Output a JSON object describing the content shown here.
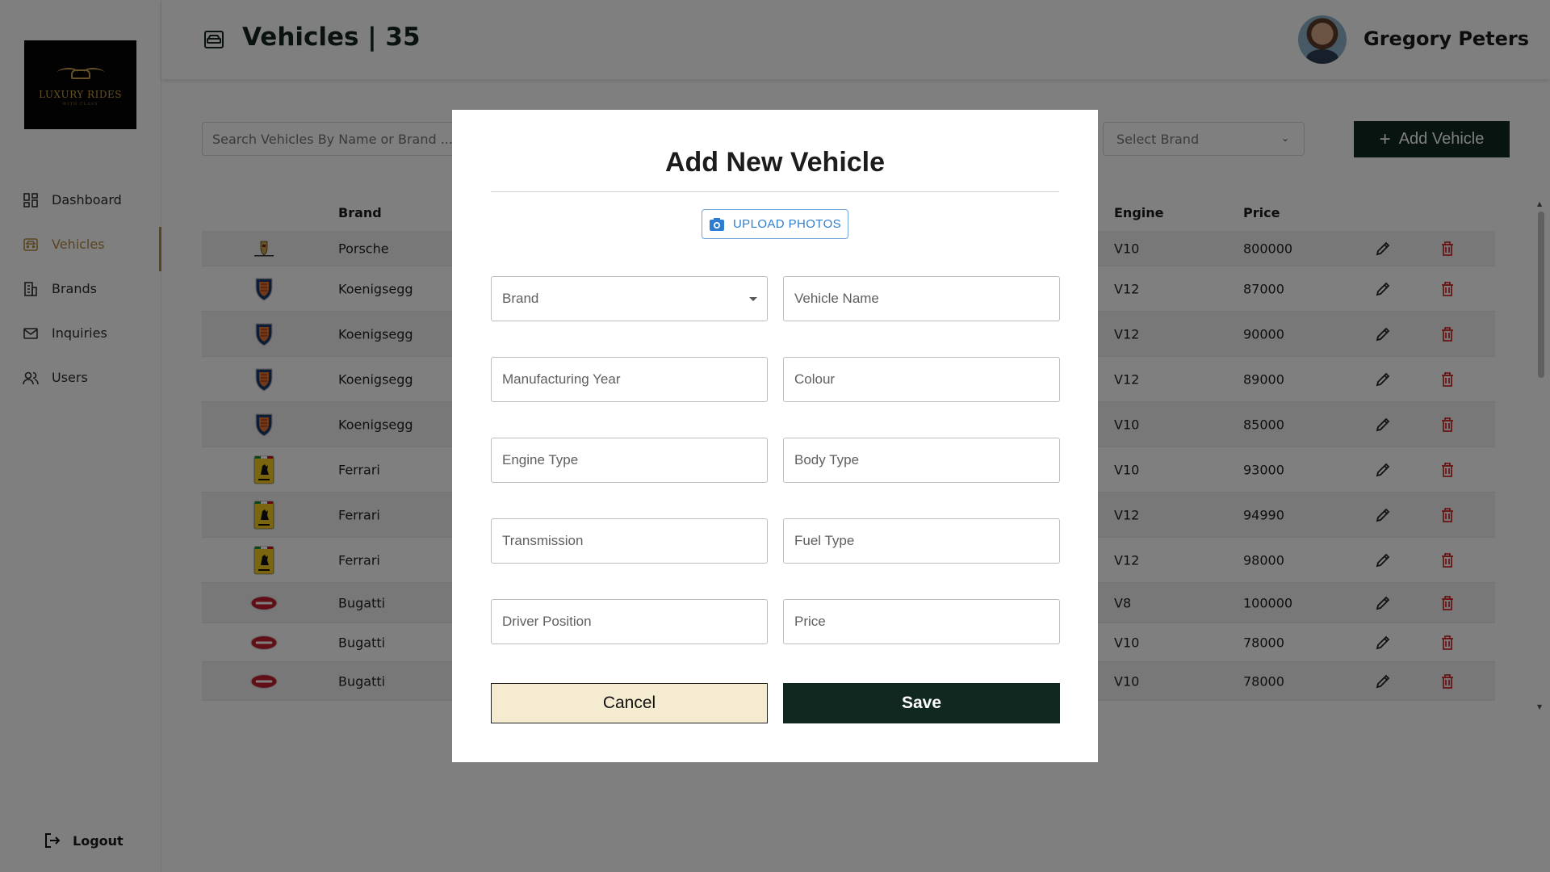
{
  "app": {
    "logo_text": "LUXURY RIDES",
    "logo_subtext": "WITH CLASS"
  },
  "sidebar": {
    "items": [
      {
        "label": "Dashboard",
        "icon": "dashboard-icon"
      },
      {
        "label": "Vehicles",
        "icon": "car-icon",
        "active": true
      },
      {
        "label": "Brands",
        "icon": "building-icon"
      },
      {
        "label": "Inquiries",
        "icon": "mail-icon"
      },
      {
        "label": "Users",
        "icon": "users-icon"
      }
    ],
    "logout_label": "Logout"
  },
  "header": {
    "title": "Vehicles | 35",
    "user_name": "Gregory Peters"
  },
  "toolbar": {
    "search_placeholder": "Search Vehicles By Name or Brand ...",
    "brand_select_placeholder": "Select Brand",
    "add_label": "Add Vehicle"
  },
  "table": {
    "columns": [
      "Brand",
      "Engine",
      "Price"
    ],
    "rows": [
      {
        "brand": "Porsche",
        "engine": "V10",
        "price": "800000",
        "logo": "porsche-logo-icon"
      },
      {
        "brand": "Koenigsegg",
        "engine": "V12",
        "price": "87000",
        "logo": "koenigsegg-logo-icon"
      },
      {
        "brand": "Koenigsegg",
        "engine": "V12",
        "price": "90000",
        "logo": "koenigsegg-logo-icon"
      },
      {
        "brand": "Koenigsegg",
        "engine": "V12",
        "price": "89000",
        "logo": "koenigsegg-logo-icon"
      },
      {
        "brand": "Koenigsegg",
        "engine": "V10",
        "price": "85000",
        "logo": "koenigsegg-logo-icon"
      },
      {
        "brand": "Ferrari",
        "engine": "V10",
        "price": "93000",
        "logo": "ferrari-logo-icon"
      },
      {
        "brand": "Ferrari",
        "engine": "V12",
        "price": "94990",
        "logo": "ferrari-logo-icon"
      },
      {
        "brand": "Ferrari",
        "engine": "V12",
        "price": "98000",
        "logo": "ferrari-logo-icon"
      },
      {
        "brand": "Bugatti",
        "engine": "V8",
        "price": "100000",
        "logo": "bugatti-logo-icon"
      },
      {
        "brand": "Bugatti",
        "engine": "V10",
        "price": "78000",
        "logo": "bugatti-logo-icon"
      },
      {
        "brand": "Bugatti",
        "engine": "V10",
        "price": "78000",
        "logo": "bugatti-logo-icon"
      }
    ]
  },
  "modal": {
    "title": "Add New Vehicle",
    "upload_label": "UPLOAD PHOTOS",
    "fields": {
      "brand": "Brand",
      "vehicle_name": "Vehicle Name",
      "manufacturing_year": "Manufacturing Year",
      "colour": "Colour",
      "engine_type": "Engine Type",
      "body_type": "Body Type",
      "transmission": "Transmission",
      "fuel_type": "Fuel Type",
      "driver_position": "Driver Position",
      "price": "Price"
    },
    "cancel_label": "Cancel",
    "save_label": "Save"
  },
  "colors": {
    "accent": "#b4893e",
    "primary_dark": "#112821",
    "cancel_bg": "#f5ebd1",
    "delete_red": "#d32f2f",
    "upload_blue": "#2f7dd1"
  }
}
